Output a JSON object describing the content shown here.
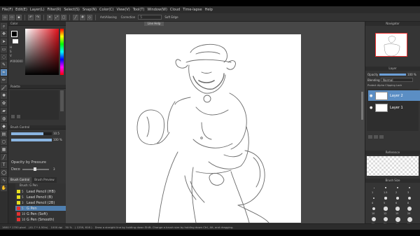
{
  "menu": {
    "items": [
      "File(F)",
      "Edit(E)",
      "Layer(L)",
      "Filter(R)",
      "Select(S)",
      "Snap(N)",
      "Color(C)",
      "View(V)",
      "Tool(T)",
      "Window(W)",
      "Cloud",
      "Time-lapse",
      "Help"
    ]
  },
  "command_bar": {
    "antialiasing_label": "AntiAliasing",
    "correction_label": "Correction",
    "correction_value": "5",
    "snap_label": "Soft Edge"
  },
  "color_panel": {
    "title": "Color",
    "h_label": "H",
    "s_label": "S",
    "v_label": "V",
    "hex": "#000000",
    "accent": "#e0101a"
  },
  "palette_panel": {
    "title": "Palette"
  },
  "brush_control": {
    "title": "Brush Control",
    "size_value": "10.5",
    "opacity_value": "100 %",
    "size_fraction": 0.8,
    "opacity_fraction": 1.0,
    "opacity_pressure_label": "Opacity by Pressure",
    "smooth_label": "Deco",
    "smooth_value": "3"
  },
  "tabs": {
    "brush_control": "Brush Control",
    "brush_preview": "Brush Preview"
  },
  "subtool": {
    "title": "Brush: G Pen",
    "rows": [
      {
        "num": "5",
        "name": "Lead Pencil (HB)",
        "color": "#e8e020"
      },
      {
        "num": "5",
        "name": "Lead Pencil (B)",
        "color": "#e8e020"
      },
      {
        "num": "3",
        "name": "Lead Pencil (2B)",
        "color": "#e8e020"
      },
      {
        "num": "5",
        "name": "G Pen",
        "color": "#e33030",
        "selected": true
      },
      {
        "num": "10",
        "name": "G Pen (Soft)",
        "color": "#e33030"
      },
      {
        "num": "10",
        "name": "G Pen (Smooth)",
        "color": "#e33030"
      }
    ]
  },
  "canvas": {
    "tab_label": "Line Help"
  },
  "navigator": {
    "title": "Navigator"
  },
  "layer_panel": {
    "title": "Layer",
    "opacity_label": "Opacity",
    "opacity_value": "100 %",
    "blend_label": "Blending",
    "blend_value": "Normal",
    "checks": "Protect Alpha   Clipping   Lock",
    "layers": [
      {
        "name": "Layer 2",
        "selected": true
      },
      {
        "name": "Layer 1",
        "selected": false
      }
    ]
  },
  "reference_panel": {
    "title": "Reference"
  },
  "brush_size_panel": {
    "title": "Brush Size",
    "sizes": [
      "1",
      "1.5",
      "2",
      "3",
      "4",
      "5",
      "6",
      "8",
      "10",
      "12",
      "15",
      "20",
      "25",
      "30",
      "40",
      "50"
    ]
  },
  "status": {
    "dimensions": "1600 * 1700 pixel",
    "print_size": "(41.7 * 4.50in)",
    "dpi": "1000 dpi",
    "zoom": "30 %",
    "coords": "( 1259, 616 )",
    "hint": "Draw a straight line by holding down Shift. Change a brush size by holding down Ctrl, Alt, and dragging."
  }
}
